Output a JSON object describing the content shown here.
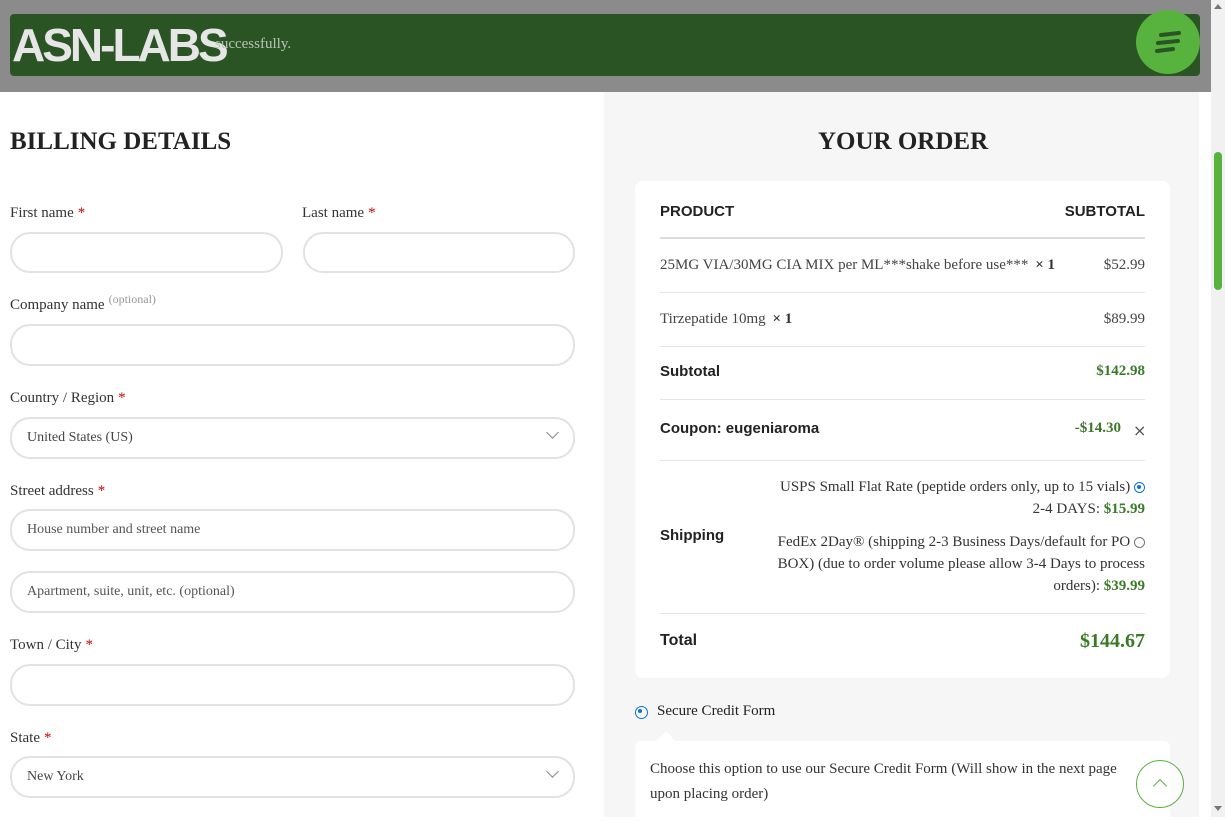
{
  "header": {
    "logo_text": "ASN-LABS",
    "notice_text": "successfully.",
    "menu_icon": "hamburger-icon"
  },
  "billing": {
    "title": "BILLING DETAILS",
    "required_mark": "*",
    "optional_mark": "(optional)",
    "first_name_label": "First name",
    "last_name_label": "Last name",
    "company_label": "Company name",
    "country_label": "Country / Region",
    "country_value": "United States (US)",
    "street_label": "Street address",
    "street_placeholder": "House number and street name",
    "apartment_placeholder": "Apartment, suite, unit, etc. (optional)",
    "city_label": "Town / City",
    "state_label": "State",
    "state_value": "New York"
  },
  "order": {
    "title": "YOUR ORDER",
    "col_product": "PRODUCT",
    "col_subtotal": "SUBTOTAL",
    "items": [
      {
        "name": "25MG VIA/30MG CIA MIX per ML***shake before use***",
        "qty": "× 1",
        "price": "$52.99"
      },
      {
        "name": "Tirzepatide 10mg",
        "qty": "× 1",
        "price": "$89.99"
      }
    ],
    "subtotal_label": "Subtotal",
    "subtotal_value": "$142.98",
    "coupon_label": "Coupon: eugeniaroma",
    "coupon_value": "-$14.30",
    "coupon_remove": "×",
    "shipping_label": "Shipping",
    "shipping_options": [
      {
        "line1": "USPS Small Flat Rate (peptide orders only, up to 15 vials)",
        "line2": "2-4 DAYS:",
        "price": "$15.99",
        "selected": true
      },
      {
        "line1": "FedEx 2Day® (shipping 2-3 Business Days/default for PO",
        "line2": "BOX) (due to order volume please allow 3-4 Days to process",
        "line3": "orders):",
        "price": "$39.99",
        "selected": false
      }
    ],
    "total_label": "Total",
    "total_value": "$144.67"
  },
  "payment": {
    "method_label": "Secure Credit Form",
    "description": "Choose this option to use our Secure Credit Form (Will show in the next page upon placing order)"
  },
  "colors": {
    "brand_green": "#57b33e",
    "notice_bg": "#2b5425",
    "price_green": "#3a7a26"
  }
}
